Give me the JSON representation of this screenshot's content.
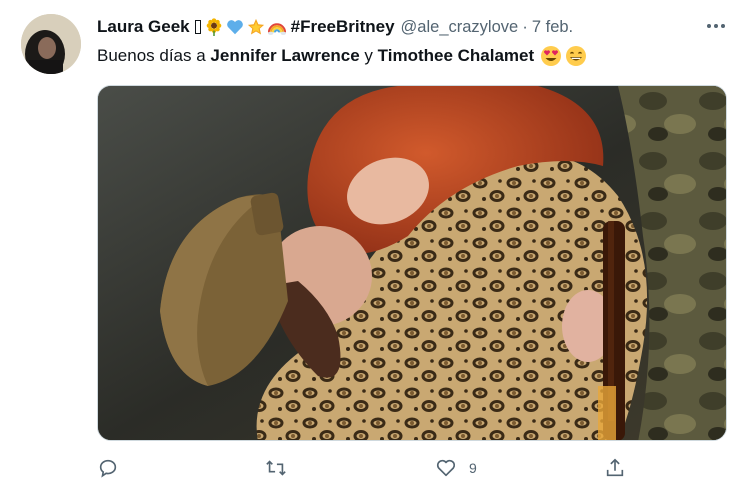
{
  "tweet": {
    "display_name": "Laura Geek",
    "name_symbol": "⁣",
    "name_emojis": [
      "sunflower-emoji",
      "blue-heart-emoji",
      "glowing-star-emoji",
      "rainbow-emoji"
    ],
    "hashtag_name": "#FreeBritney",
    "handle": "@ale_crazylove",
    "separator": "·",
    "date": "7 feb.",
    "text_before": "Buenos días a ",
    "mention1": "Jennifer Lawrence",
    "text_middle": " y ",
    "mention2": "Timothee Chalamet",
    "text_emojis": [
      "heart-eyes-emoji",
      "grinning-emoji"
    ],
    "like_count": "9"
  },
  "colors": {
    "text": "#0f1419",
    "secondary": "#536471",
    "border": "#cfd9de"
  }
}
